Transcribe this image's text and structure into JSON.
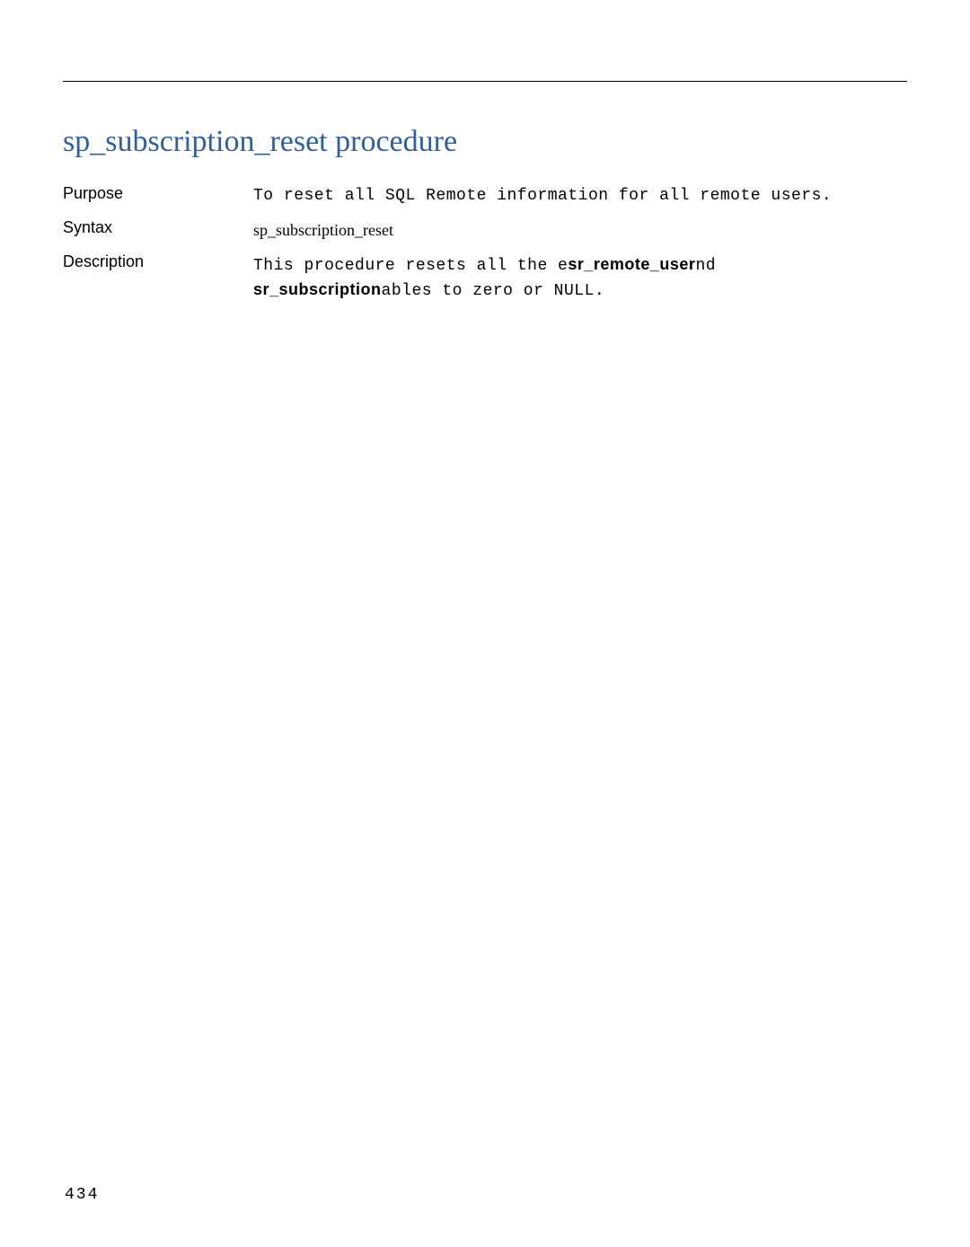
{
  "heading": "sp_subscription_reset procedure",
  "rows": {
    "purpose": {
      "label": "Purpose",
      "text": "To reset all SQL Remote information for all remote users."
    },
    "syntax": {
      "label": "Syntax",
      "text": "sp_subscription_reset"
    },
    "description": {
      "label": "Description",
      "part1": "This procedure resets all the e",
      "bold1": "sr_remote_user",
      "part2": "nd ",
      "bold2": "sr_subscription",
      "part3": "ables to zero or NULL."
    }
  },
  "page_number": "434"
}
